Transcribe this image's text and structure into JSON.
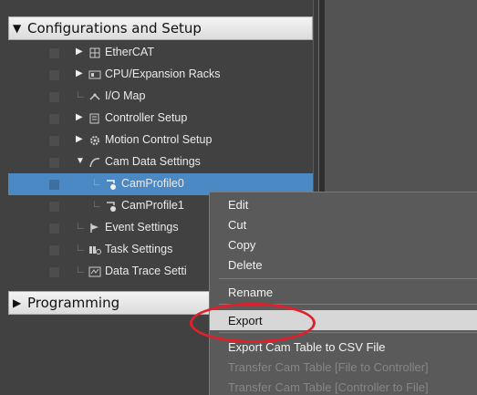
{
  "sections": {
    "configurations": {
      "label": "Configurations and Setup",
      "expanded": true
    },
    "programming": {
      "label": "Programming",
      "expanded": false
    }
  },
  "tree": {
    "ethercat": "EtherCAT",
    "cpu_racks": "CPU/Expansion Racks",
    "io_map": "I/O Map",
    "controller_setup": "Controller Setup",
    "motion_control_setup": "Motion Control Setup",
    "cam_data_settings": "Cam Data Settings",
    "cam_profile_0": "CamProfile0",
    "cam_profile_1": "CamProfile1",
    "event_settings": "Event Settings",
    "task_settings": "Task Settings",
    "data_trace_settings": "Data Trace Setti"
  },
  "context_menu": {
    "edit": "Edit",
    "cut": "Cut",
    "copy": "Copy",
    "delete": "Delete",
    "rename": "Rename",
    "export": "Export",
    "export_csv": "Export Cam Table to CSV File",
    "transfer_to_controller": "Transfer Cam Table [File to Controller]",
    "transfer_to_file": "Transfer Cam Table [Controller to File]"
  },
  "colors": {
    "selection": "#4a89c4",
    "annotation": "#e0202a",
    "menu_background": "#5a5a5a"
  },
  "icons": {
    "expand_down": "▼",
    "expand_right": "▶"
  }
}
